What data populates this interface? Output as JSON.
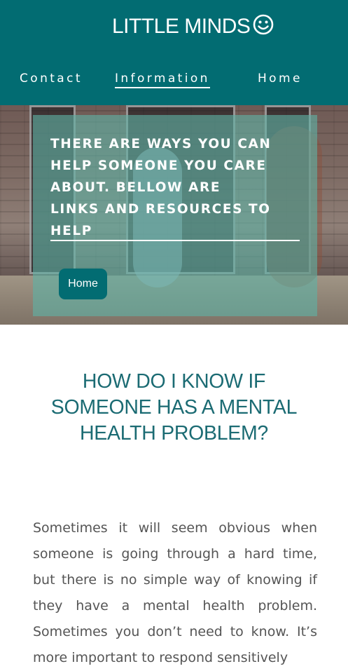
{
  "header": {
    "title": "LITTLE MINDS",
    "title_icon": "smiley-face-icon",
    "background": "#026c72"
  },
  "nav": {
    "items": [
      {
        "label": "Contact"
      },
      {
        "label": "Information",
        "active": true
      },
      {
        "label": "Home"
      }
    ]
  },
  "hero": {
    "text": "There are ways you can help someone you care about. Bellow are links and resources to help",
    "button_label": "Home",
    "overlay_color": "#60b2a5"
  },
  "main": {
    "heading": "How do I know if someone has a mental health problem?",
    "paragraph": "Sometimes it will seem obvious when someone is going through a hard time, but there is no simple way of knowing if they have a mental health problem. Sometimes you don’t need to know. It’s more important to respond sensitively"
  },
  "colors": {
    "accent": "#026c72",
    "heading": "#1b6b73",
    "body_text": "#555555"
  }
}
